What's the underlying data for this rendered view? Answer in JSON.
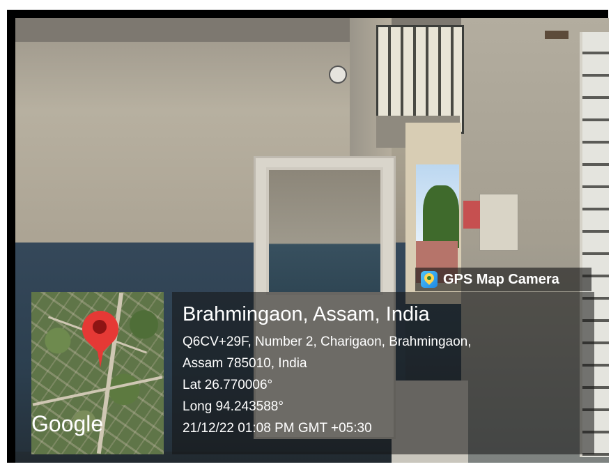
{
  "badge": {
    "icon": "gps-map-camera-app-icon",
    "label": "GPS Map Camera"
  },
  "map": {
    "pin_icon": "map-pin-icon",
    "brand": "Google"
  },
  "location": {
    "title": "Brahmingaon, Assam, India",
    "address_line1": "Q6CV+29F, Number 2, Charigaon, Brahmingaon,",
    "address_line2": "Assam 785010, India",
    "latitude": "Lat 26.770006°",
    "longitude": "Long 94.243588°",
    "datetime": "21/12/22 01:08 PM GMT +05:30"
  },
  "colors": {
    "pin": "#e53935",
    "overlay": "rgba(20,20,20,0.55)"
  }
}
